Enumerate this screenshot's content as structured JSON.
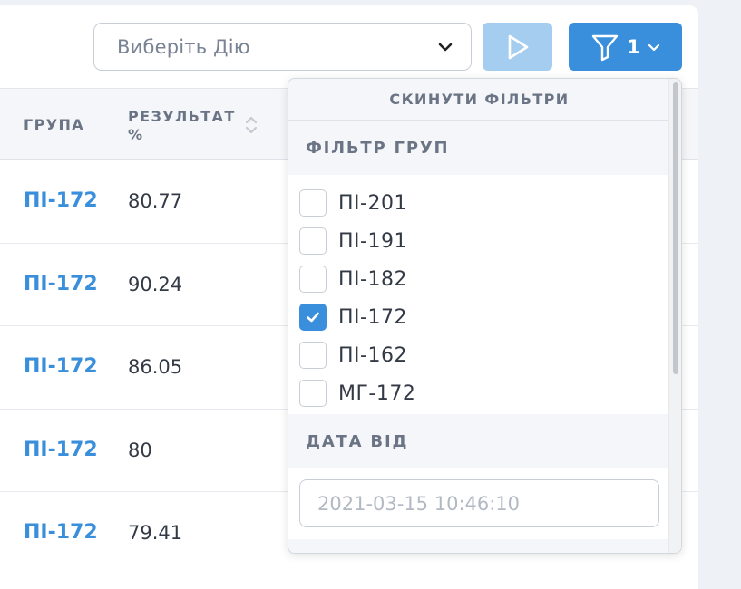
{
  "toolbar": {
    "action_placeholder": "Виберіть Дію",
    "filter_count": "1"
  },
  "table": {
    "headers": {
      "group": "ГРУПА",
      "result": "РЕЗУЛЬТАТ %"
    },
    "rows": [
      {
        "group": "ПІ-172",
        "result": "80.77"
      },
      {
        "group": "ПІ-172",
        "result": "90.24"
      },
      {
        "group": "ПІ-172",
        "result": "86.05"
      },
      {
        "group": "ПІ-172",
        "result": "80"
      },
      {
        "group": "ПІ-172",
        "result": "79.41"
      }
    ]
  },
  "filter_dropdown": {
    "reset_label": "СКИНУТИ ФІЛЬТРИ",
    "groups_title": "ФІЛЬТР ГРУП",
    "group_options": [
      {
        "label": "ПІ-201",
        "checked": false
      },
      {
        "label": "ПІ-191",
        "checked": false
      },
      {
        "label": "ПІ-182",
        "checked": false
      },
      {
        "label": "ПІ-172",
        "checked": true
      },
      {
        "label": "ПІ-162",
        "checked": false
      },
      {
        "label": "МГ-172",
        "checked": false
      }
    ],
    "date_from_title": "ДАТА ВІД",
    "date_from_placeholder": "2021-03-15 10:46:10"
  },
  "colors": {
    "accent": "#3a8fdc",
    "accent_light": "#a5cdf0",
    "header_bg": "#f4f6f9",
    "text_muted": "#6b7484"
  }
}
